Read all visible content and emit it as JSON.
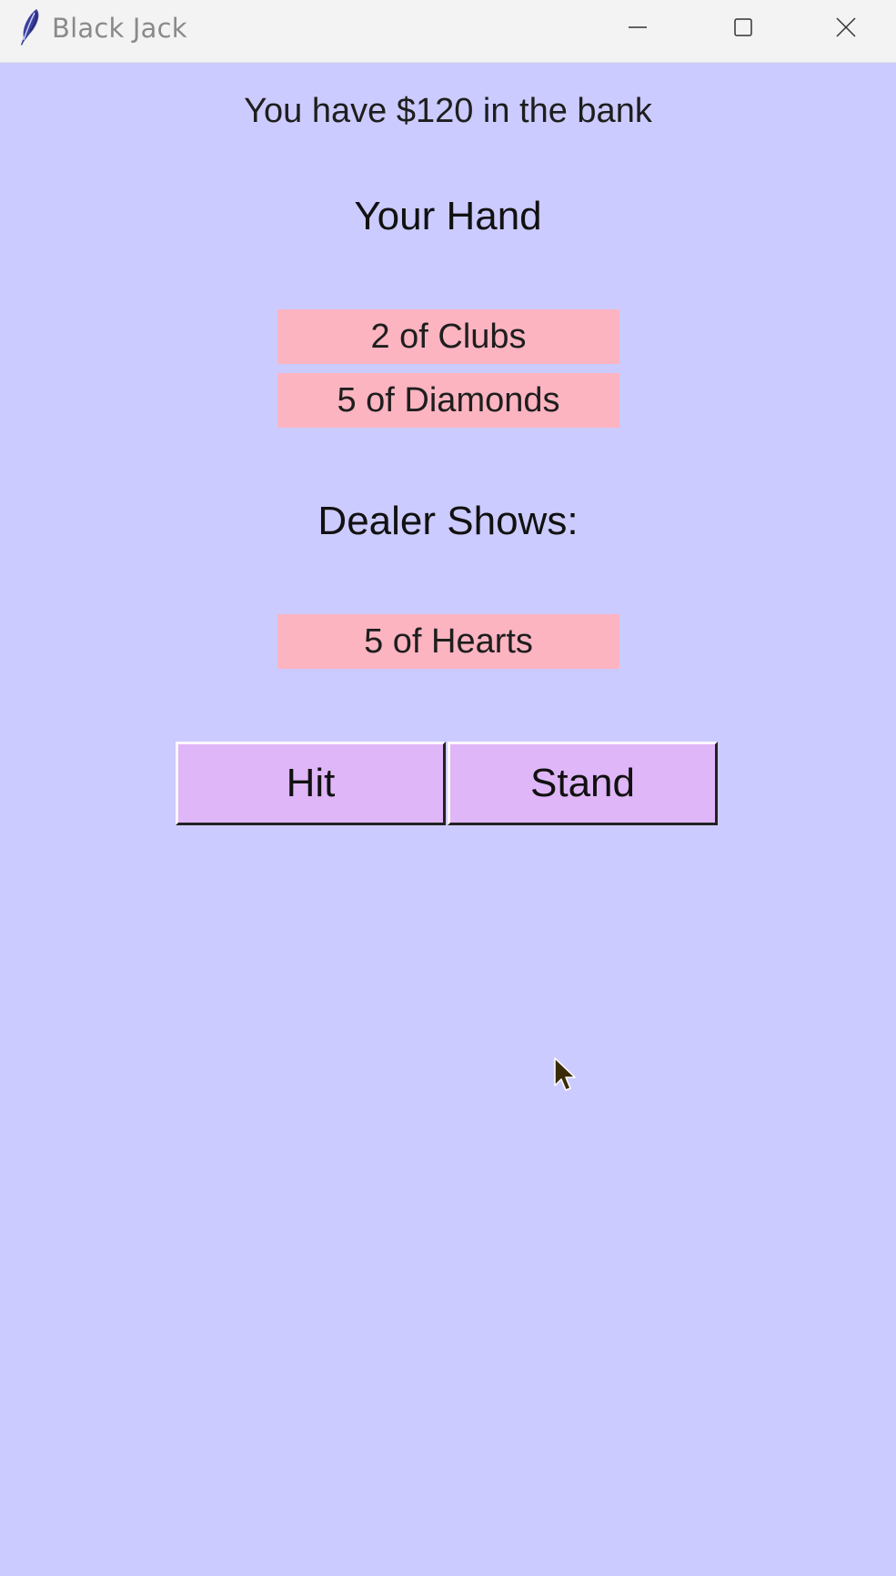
{
  "window": {
    "title": "Black Jack",
    "icons": {
      "app": "feather-icon",
      "minimize": "minimize-icon",
      "maximize": "maximize-icon",
      "close": "close-icon"
    }
  },
  "bank": {
    "text": "You have $120 in the bank"
  },
  "player": {
    "heading": "Your Hand",
    "cards": [
      "2 of Clubs",
      "5 of Diamonds"
    ]
  },
  "dealer": {
    "heading": "Dealer Shows:",
    "cards": [
      "5 of Hearts"
    ]
  },
  "actions": {
    "hit_label": "Hit",
    "stand_label": "Stand"
  },
  "colors": {
    "background": "#cccbff",
    "card": "#fcb4c1",
    "button": "#dfb6f7",
    "titlebar": "#f3f3f3"
  }
}
